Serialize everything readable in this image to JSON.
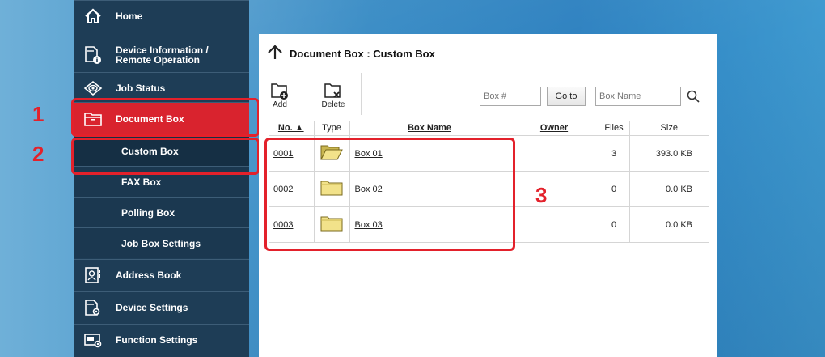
{
  "sidebar": {
    "items": [
      {
        "label": "Home",
        "icon": "home-icon"
      },
      {
        "label": "Device Information /",
        "label2": "Remote Operation",
        "icon": "device-info-icon"
      },
      {
        "label": "Job Status",
        "icon": "eye-icon"
      },
      {
        "label": "Document Box",
        "icon": "folder-icon",
        "active": true
      },
      {
        "label": "Custom Box",
        "sub": true,
        "selected": true
      },
      {
        "label": "FAX Box",
        "sub": true
      },
      {
        "label": "Polling Box",
        "sub": true
      },
      {
        "label": "Job Box Settings",
        "sub": true
      },
      {
        "label": "Address Book",
        "icon": "address-book-icon"
      },
      {
        "label": "Device Settings",
        "icon": "device-settings-icon"
      },
      {
        "label": "Function Settings",
        "icon": "function-settings-icon"
      }
    ]
  },
  "callouts": {
    "one": "1",
    "two": "2",
    "three": "3"
  },
  "main": {
    "title": "Document Box : Custom Box",
    "toolbar": {
      "add_label": "Add",
      "delete_label": "Delete"
    },
    "search": {
      "box_number_placeholder": "Box #",
      "goto_label": "Go to",
      "box_name_placeholder": "Box Name"
    },
    "table": {
      "headers": {
        "no": "No. ▲",
        "type": "Type",
        "box_name": "Box Name",
        "owner": "Owner",
        "files": "Files",
        "size": "Size"
      },
      "rows": [
        {
          "no": "0001",
          "name": "Box 01",
          "owner": "",
          "files": "3",
          "size": "393.0 KB",
          "icon": "folder-open-icon"
        },
        {
          "no": "0002",
          "name": "Box 02",
          "owner": "",
          "files": "0",
          "size": "0.0 KB",
          "icon": "folder-icon"
        },
        {
          "no": "0003",
          "name": "Box 03",
          "owner": "",
          "files": "0",
          "size": "0.0 KB",
          "icon": "folder-icon"
        }
      ]
    }
  },
  "colors": {
    "accent": "#d9232e",
    "sidebar": "#1e3d56",
    "callout": "#e3212b"
  }
}
